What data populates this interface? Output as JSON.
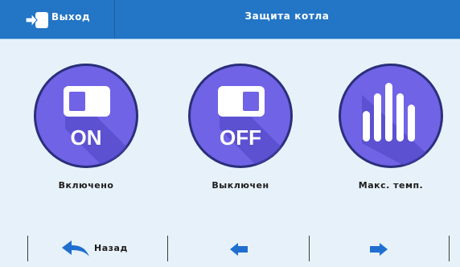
{
  "header": {
    "exit_label": "Выход",
    "title": "Защита котла"
  },
  "tiles": [
    {
      "label": "Включено",
      "icon_text": "ON",
      "icon": "toggle-on-icon"
    },
    {
      "label": "Выключен",
      "icon_text": "OFF",
      "icon": "toggle-off-icon"
    },
    {
      "label": "Макс. темп.",
      "icon": "bars-icon"
    }
  ],
  "nav": {
    "back_label": "Назад",
    "prev_icon": "arrow-left-icon",
    "next_icon": "arrow-right-icon"
  },
  "colors": {
    "header_bg": "#2375c5",
    "circle": "#7063e6",
    "circle_shadow": "#3d39a7",
    "nav_arrow": "#1f6fd1",
    "background": "#e7f1f9"
  }
}
